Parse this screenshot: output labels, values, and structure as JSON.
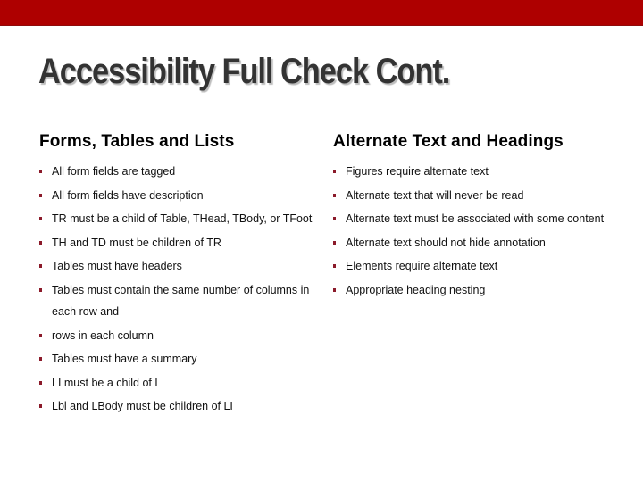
{
  "slide": {
    "title": "Accessibility Full Check Cont.",
    "accent_color": "#ae0000",
    "bullet_color": "#8b1a2a",
    "left_column": {
      "heading": "Forms, Tables and Lists",
      "items": [
        "All form fields are tagged",
        "All form fields have description",
        "TR must be a child of Table, THead, TBody, or TFoot",
        "TH and TD must be children of TR",
        "Tables must have headers",
        "Tables must contain the same number of columns in each row and",
        "rows in each column",
        "Tables must have a summary",
        "LI must be a child of L",
        "Lbl and LBody must be children of LI"
      ]
    },
    "right_column": {
      "heading": "Alternate Text and Headings",
      "items": [
        "Figures require alternate text",
        "Alternate text that will never be read",
        "Alternate text must be associated with some content",
        "Alternate text should not hide annotation",
        "Elements require alternate text",
        "Appropriate heading nesting"
      ]
    }
  }
}
